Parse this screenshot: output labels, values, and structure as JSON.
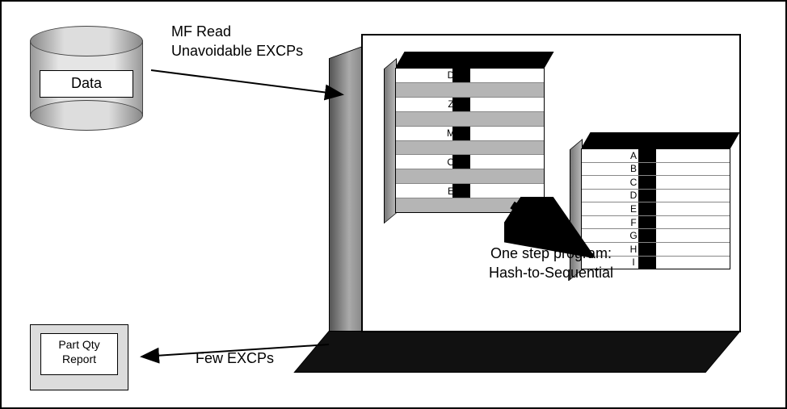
{
  "db": {
    "label": "Data"
  },
  "arrow_in": {
    "line1": "MF Read",
    "line2": "Unavoidable EXCPs"
  },
  "arrow_out": {
    "label": "Few EXCPs"
  },
  "report": {
    "line1": "Part Qty",
    "line2": "Report"
  },
  "proc": {
    "line1": "One step program:",
    "line2": "Hash-to-Sequential"
  },
  "hash_table": {
    "rows": [
      {
        "type": "data",
        "letter": "D"
      },
      {
        "type": "blank",
        "letter": ""
      },
      {
        "type": "data",
        "letter": "Z"
      },
      {
        "type": "blank",
        "letter": ""
      },
      {
        "type": "data",
        "letter": "M"
      },
      {
        "type": "blank",
        "letter": ""
      },
      {
        "type": "data",
        "letter": "O"
      },
      {
        "type": "blank",
        "letter": ""
      },
      {
        "type": "data",
        "letter": "E"
      },
      {
        "type": "blank",
        "letter": ""
      }
    ]
  },
  "seq_table": {
    "rows": [
      {
        "letter": "A"
      },
      {
        "letter": "B"
      },
      {
        "letter": "C"
      },
      {
        "letter": "D"
      },
      {
        "letter": "E"
      },
      {
        "letter": "F"
      },
      {
        "letter": "G"
      },
      {
        "letter": "H"
      },
      {
        "letter": "I"
      }
    ]
  }
}
